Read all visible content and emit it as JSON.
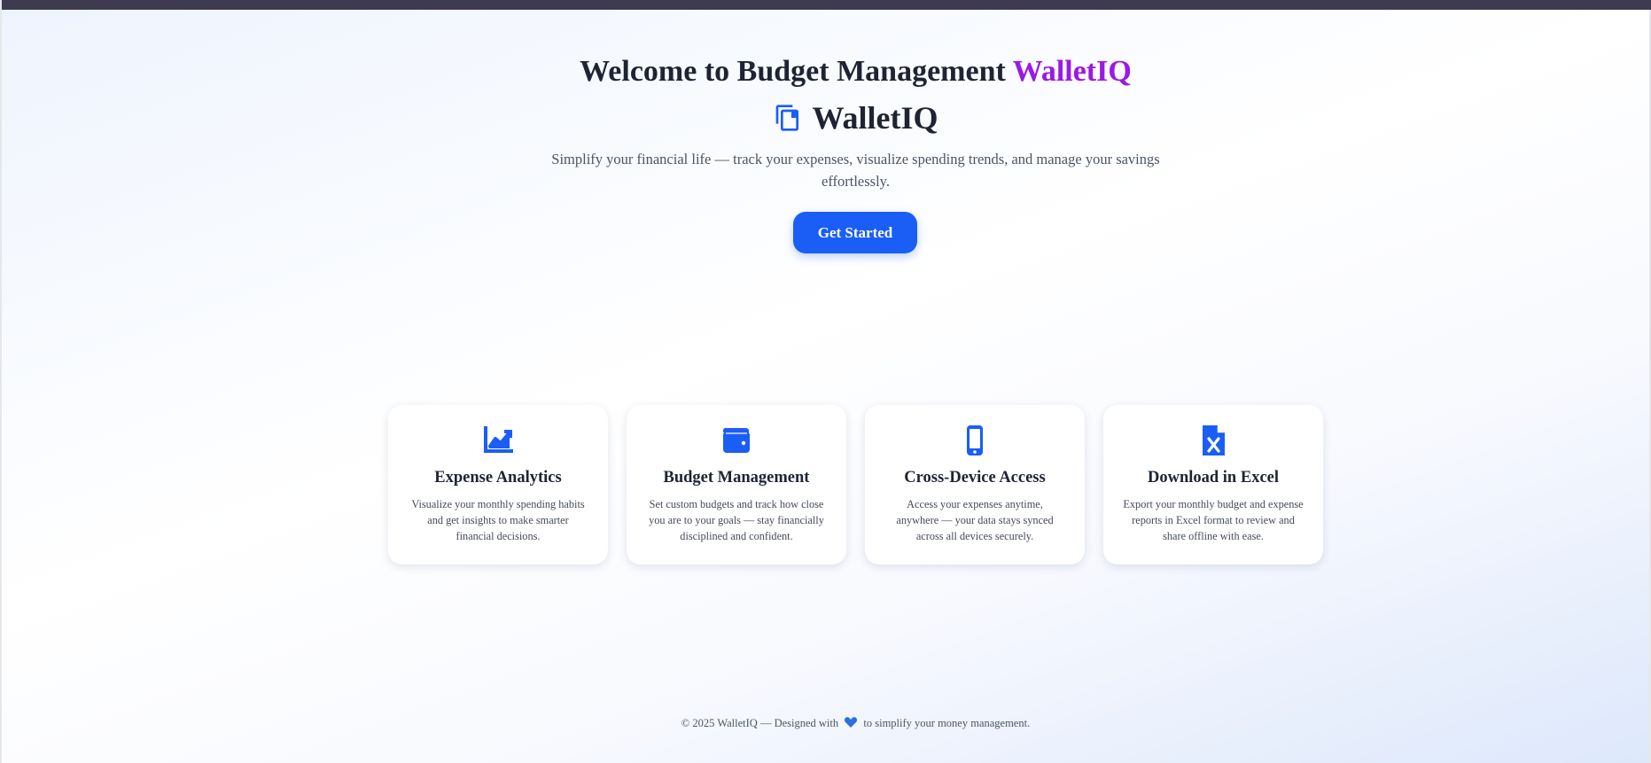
{
  "hero": {
    "title_prefix": "Welcome to Budget Management",
    "title_brand": "WalletIQ",
    "brand_name": "WalletIQ",
    "tagline": "Simplify your financial life — track your expenses, visualize spending trends, and manage your savings effortlessly.",
    "cta_label": "Get Started"
  },
  "features": [
    {
      "icon": "chart-line-up-icon",
      "title": "Expense Analytics",
      "description": "Visualize your monthly spending habits and get insights to make smarter financial decisions."
    },
    {
      "icon": "wallet-icon",
      "title": "Budget Management",
      "description": "Set custom budgets and track how close you are to your goals — stay financially disciplined and confident."
    },
    {
      "icon": "mobile-phone-icon",
      "title": "Cross-Device Access",
      "description": "Access your expenses anytime, anywhere — your data stays synced across all devices securely."
    },
    {
      "icon": "excel-file-icon",
      "title": "Download in Excel",
      "description": "Export your monthly budget and expense reports in Excel format to review and share offline with ease."
    }
  ],
  "footer": {
    "text_before": "© 2025 WalletIQ — Designed with",
    "heart_icon": "heart-icon",
    "text_after": "to simplify your money management."
  },
  "colors": {
    "accent": "#1a5ef5",
    "brand_purple": "#9b19e4",
    "heading": "#1e2433",
    "top_bar": "#3e3a4f",
    "heart": "#2f6fe0"
  }
}
